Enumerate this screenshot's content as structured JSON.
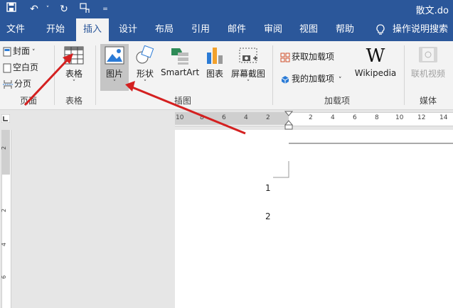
{
  "window": {
    "title": "散文.do"
  },
  "tabs": [
    {
      "label": "文件"
    },
    {
      "label": "开始"
    },
    {
      "label": "插入"
    },
    {
      "label": "设计"
    },
    {
      "label": "布局"
    },
    {
      "label": "引用"
    },
    {
      "label": "邮件"
    },
    {
      "label": "审阅"
    },
    {
      "label": "视图"
    },
    {
      "label": "帮助"
    }
  ],
  "tell_me": "操作说明搜索",
  "ribbon": {
    "pages": {
      "cover": "封面",
      "blank": "空白页",
      "break": "分页",
      "label": "页面"
    },
    "table": {
      "button": "表格",
      "label": "表格"
    },
    "illustrations": {
      "picture": "图片",
      "shapes": "形状",
      "smartart": "SmartArt",
      "chart": "图表",
      "screenshot": "屏幕截图",
      "label": "插图"
    },
    "addins": {
      "get": "获取加载项",
      "mine": "我的加载项",
      "wikipedia": "Wikipedia",
      "wiki_logo": "W",
      "label": "加载项"
    },
    "media": {
      "online_video": "联机视频",
      "label": "媒体"
    }
  },
  "ruler": {
    "left_marks": [
      "10",
      "8",
      "6",
      "4",
      "2"
    ],
    "right_marks": [
      "2",
      "4",
      "6",
      "8",
      "10",
      "12",
      "14"
    ],
    "vertical_marks": [
      "2",
      "2",
      "4",
      "6"
    ]
  },
  "document": {
    "lines": [
      "1",
      "2"
    ]
  },
  "colors": {
    "accent": "#2b579a",
    "arrow": "#d42020",
    "ribbon": "#f3f3f3"
  }
}
